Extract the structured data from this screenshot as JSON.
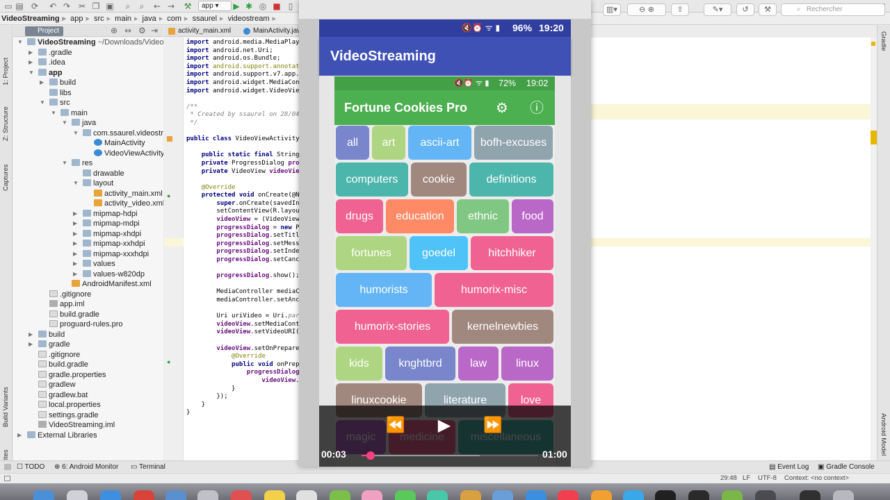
{
  "ide": {
    "run_config": "app",
    "breadcrumbs": [
      "VideoStreaming",
      "app",
      "src",
      "main",
      "java",
      "com",
      "ssaurel",
      "videostream"
    ],
    "project_tab": "Project",
    "file_tabs": [
      "activity_main.xml",
      "MainActivity.java"
    ],
    "left_tabs": [
      "1: Project",
      "Z: Structure",
      "Captures",
      "Build Variants",
      "2: Favorites"
    ],
    "right_tabs": [
      "Gradle",
      "Android Model"
    ],
    "tree": [
      {
        "label": "VideoStreaming",
        "extra": "~/Downloads/VideoS",
        "depth": 0,
        "icon": "folder",
        "open": true,
        "bold": true
      },
      {
        "label": ".gradle",
        "depth": 1,
        "icon": "folder",
        "open": false
      },
      {
        "label": ".idea",
        "depth": 1,
        "icon": "folder",
        "open": false
      },
      {
        "label": "app",
        "depth": 1,
        "icon": "folder",
        "open": true,
        "bold": true
      },
      {
        "label": "build",
        "depth": 2,
        "icon": "folder",
        "open": false
      },
      {
        "label": "libs",
        "depth": 2,
        "icon": "folder"
      },
      {
        "label": "src",
        "depth": 2,
        "icon": "folder",
        "open": true
      },
      {
        "label": "main",
        "depth": 3,
        "icon": "folder",
        "open": true
      },
      {
        "label": "java",
        "depth": 4,
        "icon": "folder",
        "open": true
      },
      {
        "label": "com.ssaurel.videostrea",
        "depth": 5,
        "icon": "folder",
        "open": true
      },
      {
        "label": "MainActivity",
        "depth": 6,
        "icon": "cls"
      },
      {
        "label": "VideoViewActivity",
        "depth": 6,
        "icon": "cls"
      },
      {
        "label": "res",
        "depth": 4,
        "icon": "folder",
        "open": true
      },
      {
        "label": "drawable",
        "depth": 5,
        "icon": "folder"
      },
      {
        "label": "layout",
        "depth": 5,
        "icon": "folder",
        "open": true
      },
      {
        "label": "activity_main.xml",
        "depth": 6,
        "icon": "xml"
      },
      {
        "label": "activity_video.xml",
        "depth": 6,
        "icon": "xml"
      },
      {
        "label": "mipmap-hdpi",
        "depth": 5,
        "icon": "folder",
        "open": false
      },
      {
        "label": "mipmap-mdpi",
        "depth": 5,
        "icon": "folder",
        "open": false
      },
      {
        "label": "mipmap-xhdpi",
        "depth": 5,
        "icon": "folder",
        "open": false
      },
      {
        "label": "mipmap-xxhdpi",
        "depth": 5,
        "icon": "folder",
        "open": false
      },
      {
        "label": "mipmap-xxxhdpi",
        "depth": 5,
        "icon": "folder",
        "open": false
      },
      {
        "label": "values",
        "depth": 5,
        "icon": "folder",
        "open": false
      },
      {
        "label": "values-w820dp",
        "depth": 5,
        "icon": "folder",
        "open": false
      },
      {
        "label": "AndroidManifest.xml",
        "depth": 4,
        "icon": "xml"
      },
      {
        "label": ".gitignore",
        "depth": 2,
        "icon": "file"
      },
      {
        "label": "app.iml",
        "depth": 2,
        "icon": "iml"
      },
      {
        "label": "build.gradle",
        "depth": 2,
        "icon": "file"
      },
      {
        "label": "proguard-rules.pro",
        "depth": 2,
        "icon": "file"
      },
      {
        "label": "build",
        "depth": 1,
        "icon": "folder",
        "open": false
      },
      {
        "label": "gradle",
        "depth": 1,
        "icon": "folder",
        "open": false
      },
      {
        "label": ".gitignore",
        "depth": 1,
        "icon": "file"
      },
      {
        "label": "build.gradle",
        "depth": 1,
        "icon": "file"
      },
      {
        "label": "gradle.properties",
        "depth": 1,
        "icon": "file"
      },
      {
        "label": "gradlew",
        "depth": 1,
        "icon": "file"
      },
      {
        "label": "gradlew.bat",
        "depth": 1,
        "icon": "file"
      },
      {
        "label": "local.properties",
        "depth": 1,
        "icon": "file"
      },
      {
        "label": "settings.gradle",
        "depth": 1,
        "icon": "file"
      },
      {
        "label": "VideoStreaming.iml",
        "depth": 1,
        "icon": "iml"
      },
      {
        "label": "External Libraries",
        "depth": 0,
        "icon": "folder",
        "open": false
      }
    ],
    "code": [
      [
        [
          "kw",
          "import "
        ],
        [
          "",
          "android.media.MediaPlaye"
        ]
      ],
      [
        [
          "kw",
          "import "
        ],
        [
          "",
          "android.net.Uri;"
        ]
      ],
      [
        [
          "kw",
          "import "
        ],
        [
          "",
          "android.os.Bundle;"
        ]
      ],
      [
        [
          "kw",
          "import "
        ],
        [
          "an",
          "android.support.annotati"
        ]
      ],
      [
        [
          "kw",
          "import "
        ],
        [
          "",
          "android.support.v7.app.A"
        ]
      ],
      [
        [
          "kw",
          "import "
        ],
        [
          "",
          "android.widget.MediaCont"
        ]
      ],
      [
        [
          "kw",
          "import "
        ],
        [
          "",
          "android.widget.VideoView"
        ]
      ],
      [
        [
          "",
          ""
        ]
      ],
      [
        [
          "cm",
          "/**"
        ]
      ],
      [
        [
          "cm",
          " * Created by ssaurel on 28/04/"
        ]
      ],
      [
        [
          "cm",
          " */"
        ]
      ],
      [
        [
          "",
          ""
        ]
      ],
      [
        [
          "kw",
          "public class "
        ],
        [
          "",
          "VideoViewActivity"
        ]
      ],
      [
        [
          "",
          ""
        ]
      ],
      [
        [
          "",
          "    "
        ],
        [
          "kw",
          "public static final "
        ],
        [
          "",
          "String"
        ]
      ],
      [
        [
          "",
          "    "
        ],
        [
          "kw",
          "private "
        ],
        [
          "",
          "ProgressDialog "
        ],
        [
          "fd",
          "prog"
        ]
      ],
      [
        [
          "",
          "    "
        ],
        [
          "kw",
          "private "
        ],
        [
          "",
          "VideoView "
        ],
        [
          "fd",
          "videoVie"
        ]
      ],
      [
        [
          "",
          ""
        ]
      ],
      [
        [
          "",
          "    "
        ],
        [
          "an",
          "@Override"
        ]
      ],
      [
        [
          "",
          "    "
        ],
        [
          "kw",
          "protected void "
        ],
        [
          "",
          "onCreate(@Nu"
        ]
      ],
      [
        [
          "",
          "        "
        ],
        [
          "kw",
          "super"
        ],
        [
          "",
          ".onCreate(savedIns"
        ]
      ],
      [
        [
          "",
          "        setContentView(R.layout"
        ]
      ],
      [
        [
          "",
          "        "
        ],
        [
          "fd",
          "videoView"
        ],
        [
          "",
          " = (VideoView"
        ]
      ],
      [
        [
          "",
          "        "
        ],
        [
          "fd",
          "progressDialog"
        ],
        [
          "",
          " = "
        ],
        [
          "kw",
          "new "
        ],
        [
          "",
          "Pr"
        ]
      ],
      [
        [
          "",
          "        "
        ],
        [
          "fd",
          "progressDialog"
        ],
        [
          "",
          ".setTitl"
        ]
      ],
      [
        [
          "",
          "        "
        ],
        [
          "fd",
          "progressDialog"
        ],
        [
          "",
          ".setMessa"
        ]
      ],
      [
        [
          "",
          "        "
        ],
        [
          "fd",
          "progressDialog"
        ],
        [
          "",
          ".setIndet"
        ]
      ],
      [
        [
          "",
          "        "
        ],
        [
          "fd",
          "progressDialog"
        ],
        [
          "",
          ".setCance"
        ]
      ],
      [
        [
          "",
          ""
        ]
      ],
      [
        [
          "",
          "        "
        ],
        [
          "fd",
          "progressDialog"
        ],
        [
          "",
          ".show();"
        ]
      ],
      [
        [
          "",
          ""
        ]
      ],
      [
        [
          "",
          "        MediaController mediaCo"
        ]
      ],
      [
        [
          "",
          "        mediaController.setAnch"
        ]
      ],
      [
        [
          "",
          ""
        ]
      ],
      [
        [
          "",
          "        Uri uriVideo = Uri."
        ],
        [
          "cm",
          "pars"
        ]
      ],
      [
        [
          "",
          "        "
        ],
        [
          "fd",
          "videoView"
        ],
        [
          "",
          ".setMediaContr"
        ]
      ],
      [
        [
          "",
          "        "
        ],
        [
          "fd",
          "videoView"
        ],
        [
          "",
          ".setVideoURI("
        ]
      ],
      [
        [
          "",
          ""
        ]
      ],
      [
        [
          "",
          "        "
        ],
        [
          "fd",
          "videoView"
        ],
        [
          "",
          ".setOnPrepared"
        ]
      ],
      [
        [
          "",
          "            "
        ],
        [
          "an",
          "@Override"
        ]
      ],
      [
        [
          "",
          "            "
        ],
        [
          "kw",
          "public void "
        ],
        [
          "",
          "onPrepa"
        ]
      ],
      [
        [
          "",
          "                "
        ],
        [
          "fd",
          "progressDialog"
        ],
        [
          "",
          "."
        ]
      ],
      [
        [
          "",
          "                    "
        ],
        [
          "fd",
          "videoView"
        ],
        [
          "",
          "."
        ]
      ],
      [
        [
          "",
          "            }"
        ]
      ],
      [
        [
          "",
          "        });"
        ]
      ],
      [
        [
          "",
          "    }"
        ]
      ],
      [
        [
          "",
          "}"
        ]
      ]
    ],
    "bottom_tools": [
      "TODO",
      "6: Android Monitor",
      "Terminal"
    ],
    "bottom_right_tools": [
      "Event Log",
      "Gradle Console"
    ],
    "status": {
      "position": "29:48",
      "line_sep": "LF",
      "encoding": "UTF-8",
      "context": "Context: <no context>"
    }
  },
  "preview": {
    "search_placeholder": "Rechercher"
  },
  "phone": {
    "status_icons": "🔇⏰ ᯤ ▮",
    "battery": "96%",
    "time": "19:20",
    "app_title": "VideoStreaming"
  },
  "video": {
    "status_icons": "🔇⏰ ᯤ ▮",
    "battery": "72%",
    "time": "19:02",
    "app_title": "Fortune Cookies Pro",
    "chips": [
      {
        "label": "all",
        "color": "#7986cb"
      },
      {
        "label": "art",
        "color": "#aed581"
      },
      {
        "label": "ascii-art",
        "color": "#64b5f6"
      },
      {
        "label": "bofh-excuses",
        "color": "#90a4ae"
      },
      {
        "label": "computers",
        "color": "#4db6ac"
      },
      {
        "label": "cookie",
        "color": "#a1887f"
      },
      {
        "label": "definitions",
        "color": "#4db6ac"
      },
      {
        "label": "drugs",
        "color": "#f06292"
      },
      {
        "label": "education",
        "color": "#ff8a65"
      },
      {
        "label": "ethnic",
        "color": "#81c784"
      },
      {
        "label": "food",
        "color": "#ba68c8"
      },
      {
        "label": "fortunes",
        "color": "#aed581"
      },
      {
        "label": "goedel",
        "color": "#4fc3f7"
      },
      {
        "label": "hitchhiker",
        "color": "#f06292"
      },
      {
        "label": "humorists",
        "color": "#64b5f6"
      },
      {
        "label": "humorix-misc",
        "color": "#f06292"
      },
      {
        "label": "humorix-stories",
        "color": "#f06292"
      },
      {
        "label": "kernelnewbies",
        "color": "#a1887f"
      },
      {
        "label": "kids",
        "color": "#aed581"
      },
      {
        "label": "knghtbrd",
        "color": "#7986cb"
      },
      {
        "label": "law",
        "color": "#ba68c8"
      },
      {
        "label": "linux",
        "color": "#ba68c8"
      },
      {
        "label": "linuxcookie",
        "color": "#a1887f"
      },
      {
        "label": "literature",
        "color": "#90a4ae"
      },
      {
        "label": "love",
        "color": "#f06292"
      },
      {
        "label": "magic",
        "color": "#ba68c8"
      },
      {
        "label": "medicine",
        "color": "#f06292"
      },
      {
        "label": "miscellaneous",
        "color": "#4db6ac"
      }
    ]
  },
  "player": {
    "current_time": "00:03",
    "total_time": "01:00",
    "progress": 0.05,
    "buffered": 0.67,
    "accent": "#ff4081"
  }
}
